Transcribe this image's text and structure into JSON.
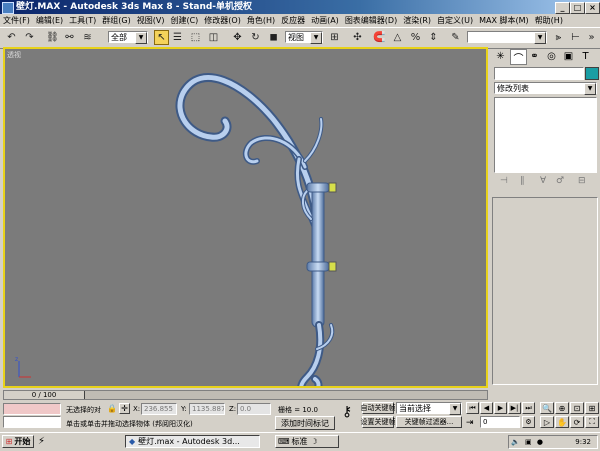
{
  "window": {
    "title": "壁灯.MAX - Autodesk 3ds Max 8 - Stand-单机授权",
    "caption_buttons": [
      "_",
      "□",
      "×"
    ]
  },
  "menu": [
    "文件(F)",
    "编辑(E)",
    "工具(T)",
    "群组(G)",
    "视图(V)",
    "创建(C)",
    "修改器(O)",
    "角色(H)",
    "反应器",
    "动画(A)",
    "图表编辑器(D)",
    "渲染(R)",
    "自定义(U)",
    "MAX 脚本(M)",
    "帮助(H)"
  ],
  "toolbar": {
    "selection_filter": "全部",
    "ref_coord": "视图",
    "named_selection": ""
  },
  "command_panel": {
    "modifier_list": "修改列表"
  },
  "timeline": {
    "frame": "0 / 100"
  },
  "status": {
    "selection": "无选择的对",
    "prompt": "单击或单击并拖动选择物体 (邦阅阳汉化)",
    "x_label": "X:",
    "x_value": "236.855",
    "y_label": "Y:",
    "y_value": "1135.887",
    "z_label": "Z:",
    "z_value": "0.0",
    "grid": "栅格 = 10.0",
    "auto_key": "自动关键帧",
    "set_key": "设置关键帧",
    "current_selection": "当前选择",
    "key_filters": "关键帧过滤器...",
    "frame_field": "0",
    "add_time_tag": "添加时间标记"
  },
  "taskbar": {
    "start": "开始",
    "task_label": "壁灯.max - Autodesk 3d...",
    "ime": "标准",
    "clock": "9:32"
  },
  "colors": {
    "viewport_bg": "#7b7b7b",
    "active_border": "#e8d21a",
    "object_color": "#a9c4e6",
    "clamp_color": "#d6df4a"
  }
}
